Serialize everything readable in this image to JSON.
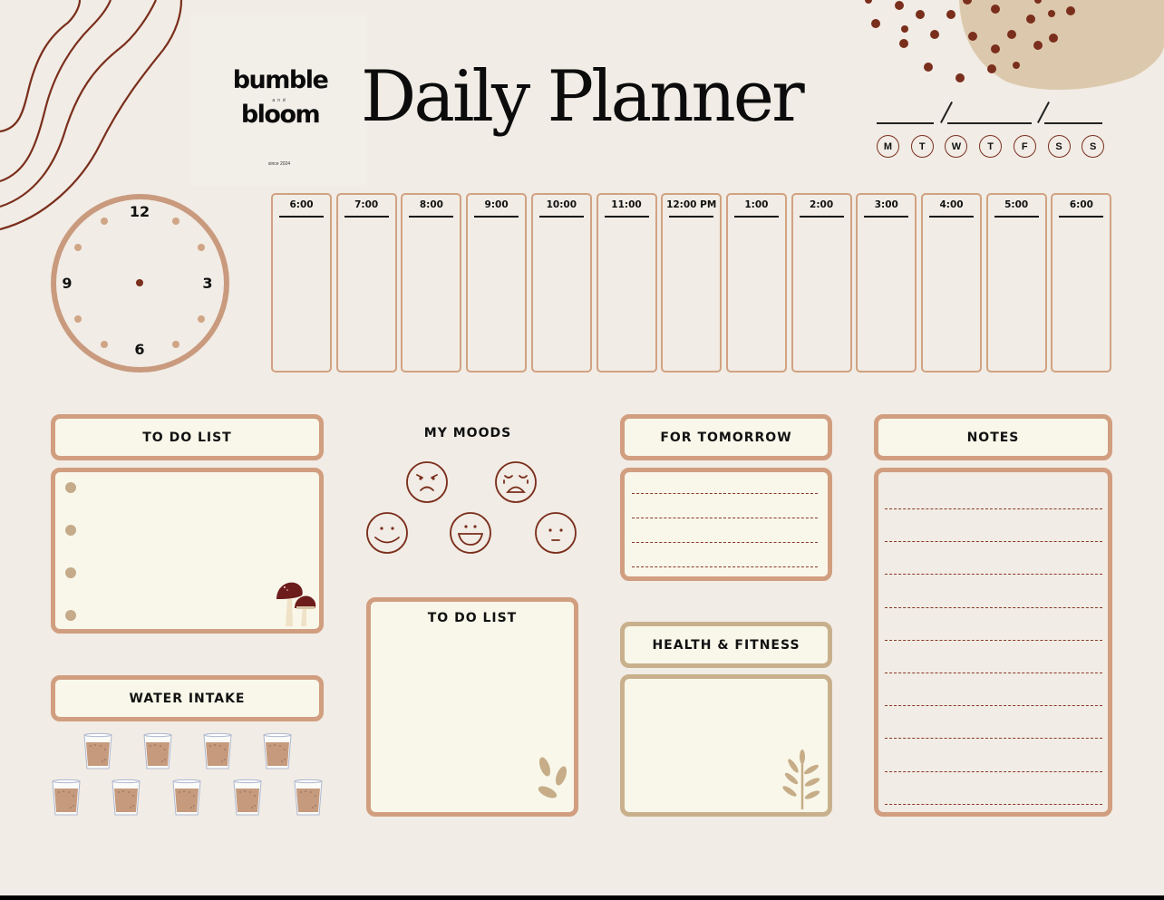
{
  "brand": {
    "line1": "bumble",
    "connector": "and",
    "line2": "bloom",
    "since": "since 2024"
  },
  "title": "Daily Planner",
  "date": {
    "separator": "/"
  },
  "days": [
    "M",
    "T",
    "W",
    "T",
    "F",
    "S",
    "S"
  ],
  "clock": {
    "numerals": {
      "top": "12",
      "right": "3",
      "bottom": "6",
      "left": "9"
    }
  },
  "schedule": {
    "slots": [
      "6:00",
      "7:00",
      "8:00",
      "9:00",
      "10:00",
      "11:00",
      "12:00 PM",
      "1:00",
      "2:00",
      "3:00",
      "4:00",
      "5:00",
      "6:00"
    ]
  },
  "sections": {
    "todo_primary": {
      "title": "TO DO LIST",
      "bullet_count": 4
    },
    "water": {
      "title": "WATER INTAKE",
      "glasses": 9
    },
    "moods": {
      "title": "MY MOODS",
      "faces": [
        "angry",
        "crying",
        "smiling",
        "laughing",
        "neutral"
      ]
    },
    "todo_secondary": {
      "title": "TO DO LIST"
    },
    "tomorrow": {
      "title": "FOR TOMORROW",
      "line_count": 4
    },
    "health": {
      "title": "HEALTH & FITNESS"
    },
    "notes": {
      "title": "NOTES",
      "line_count": 10
    }
  },
  "colors": {
    "background": "#f1ece5",
    "accent_border": "#d19e80",
    "tan_border": "#c9b08c",
    "card_fill": "#f8f7ea",
    "rust": "#7a2e1c",
    "blob": "#dcc9ad"
  }
}
